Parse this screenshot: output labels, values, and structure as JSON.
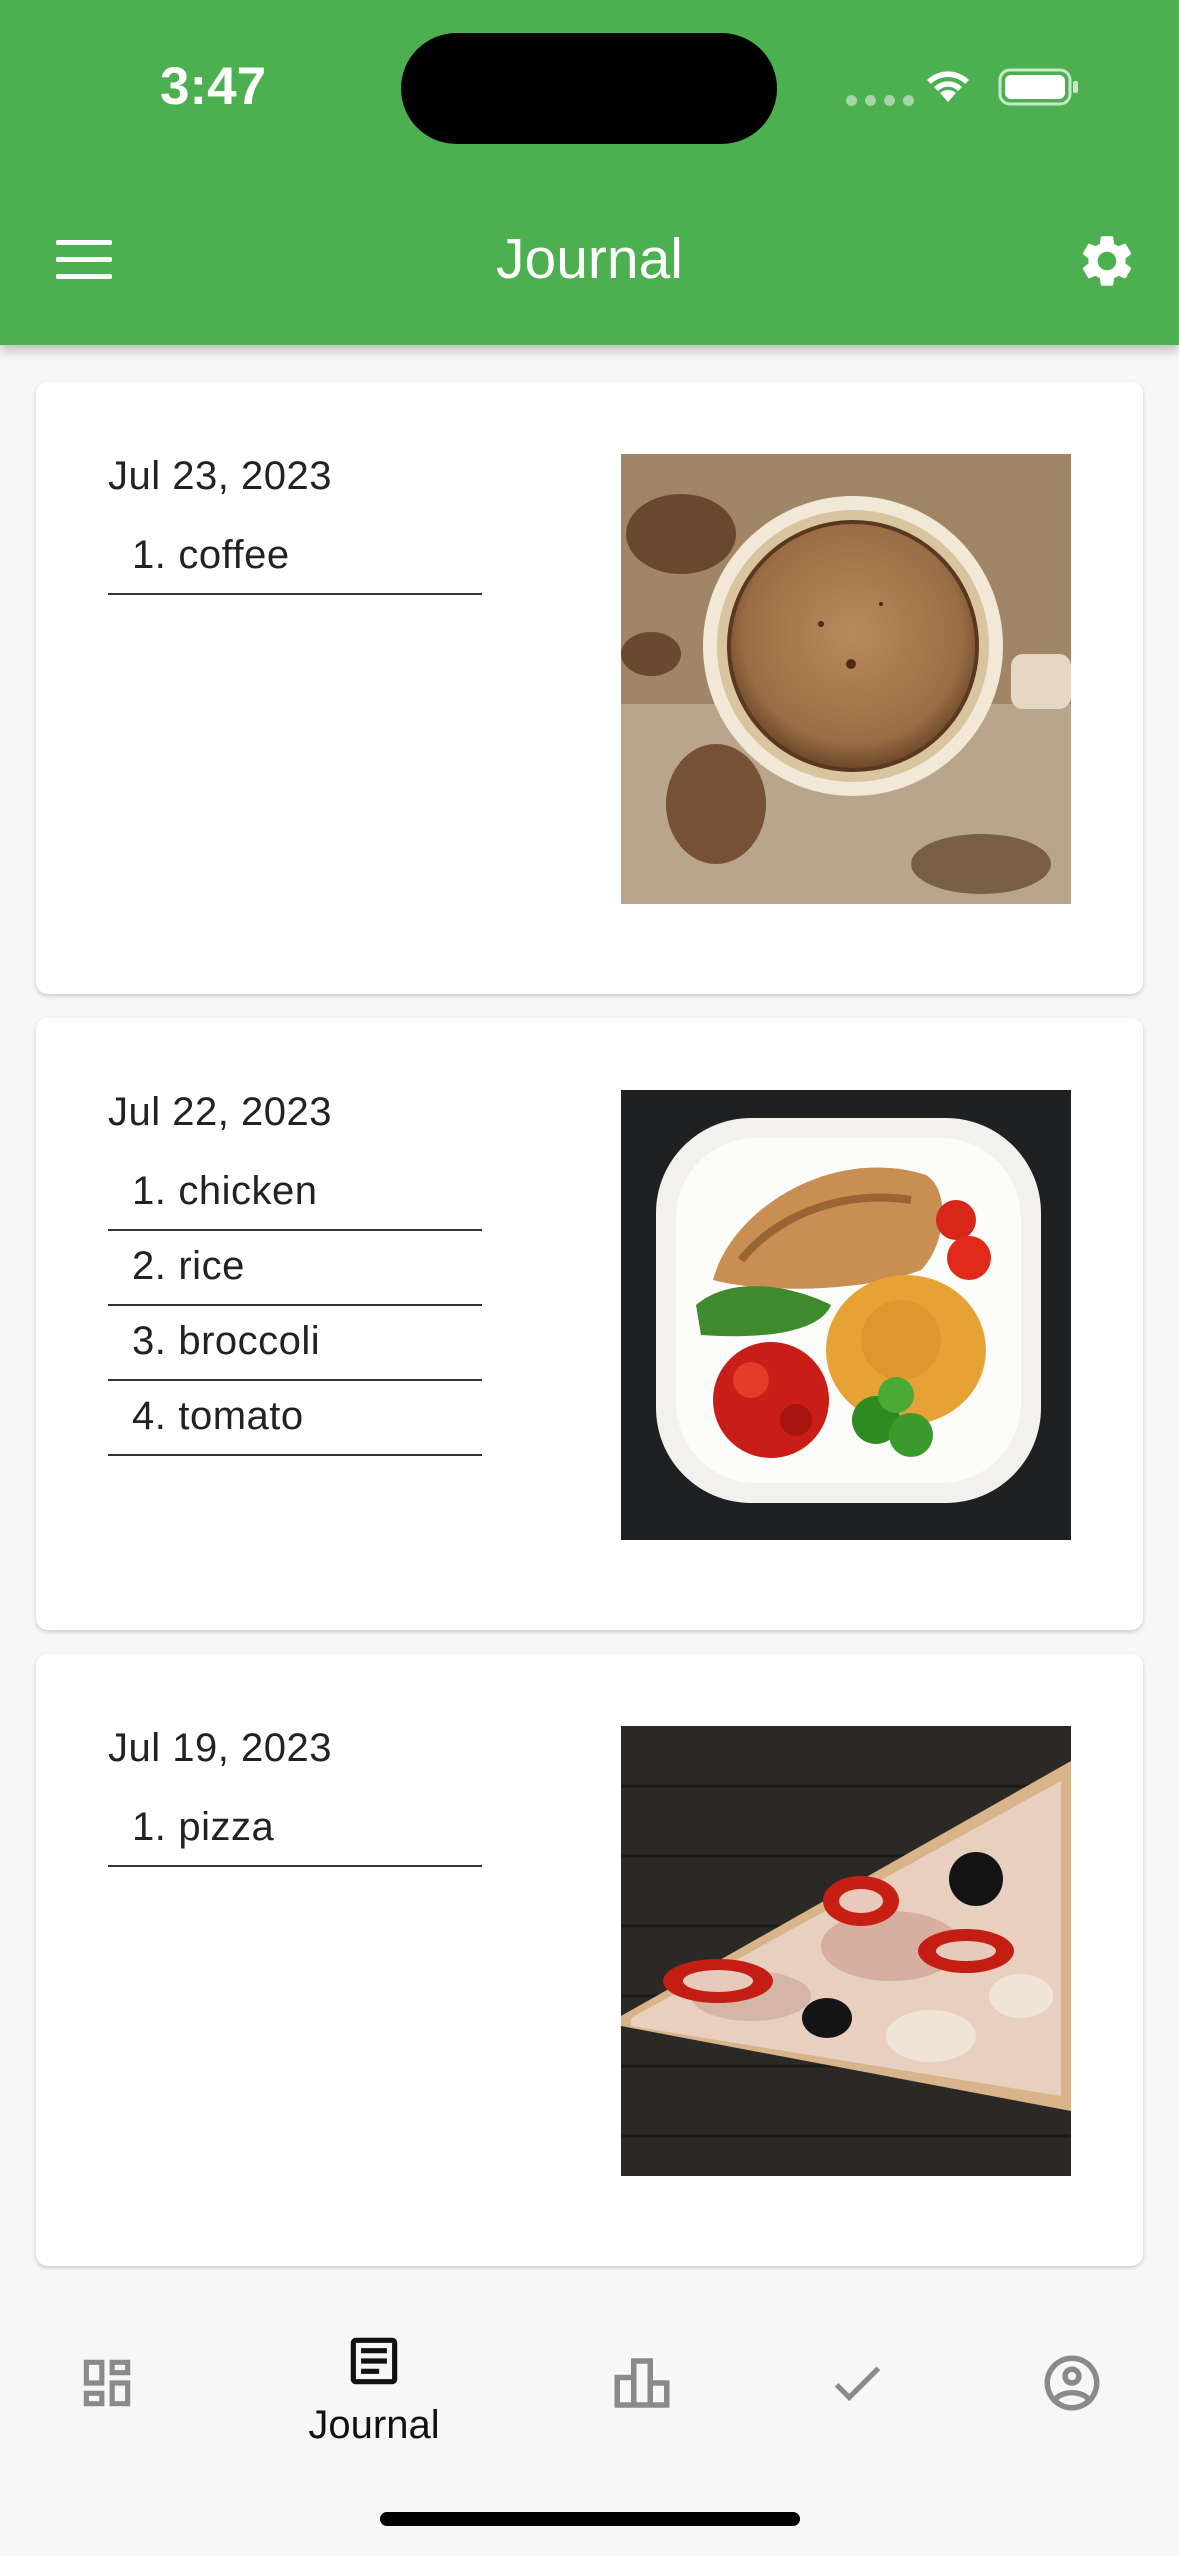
{
  "status_bar": {
    "time": "3:47"
  },
  "header": {
    "title": "Journal",
    "menu_icon": "hamburger-menu-icon",
    "settings_icon": "gear-icon",
    "color": "#4caf50"
  },
  "entries": [
    {
      "date": "Jul 23, 2023",
      "items": [
        {
          "num": "1.",
          "text": "coffee"
        }
      ],
      "photo": "coffee-photo"
    },
    {
      "date": "Jul 22, 2023",
      "items": [
        {
          "num": "1.",
          "text": "chicken"
        },
        {
          "num": "2.",
          "text": "rice"
        },
        {
          "num": "3.",
          "text": "broccoli"
        },
        {
          "num": "4.",
          "text": "tomato"
        }
      ],
      "photo": "chicken-plate-photo"
    },
    {
      "date": "Jul 19, 2023",
      "items": [
        {
          "num": "1.",
          "text": "pizza"
        }
      ],
      "photo": "pizza-photo"
    }
  ],
  "bottom_nav": {
    "items": [
      {
        "icon": "dashboard-icon",
        "label": ""
      },
      {
        "icon": "journal-icon",
        "label": "Journal",
        "selected": true
      },
      {
        "icon": "bar-chart-icon",
        "label": ""
      },
      {
        "icon": "checkmark-icon",
        "label": ""
      },
      {
        "icon": "account-circle-icon",
        "label": ""
      }
    ]
  }
}
